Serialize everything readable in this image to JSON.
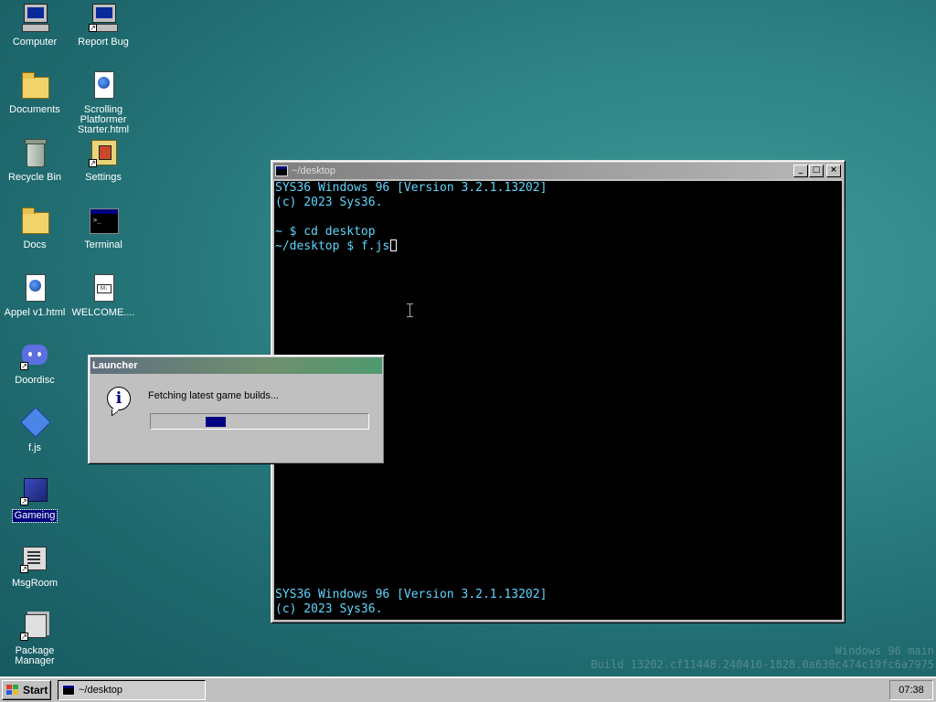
{
  "desktop_icons": [
    {
      "label": "Computer"
    },
    {
      "label": "Report Bug"
    },
    {
      "label": "Documents"
    },
    {
      "label": "Scrolling Platformer Starter.html"
    },
    {
      "label": "Recycle Bin"
    },
    {
      "label": "Settings"
    },
    {
      "label": "Docs"
    },
    {
      "label": "Terminal"
    },
    {
      "label": "Appel v1.html"
    },
    {
      "label": "WELCOME...."
    },
    {
      "label": "Doordisc"
    },
    {
      "label": "f.js"
    },
    {
      "label": "Gameing"
    },
    {
      "label": "MsgRoom"
    },
    {
      "label": "Package Manager"
    }
  ],
  "terminal": {
    "title": "~/desktop",
    "lines": [
      "SYS36 Windows 96 [Version 3.2.1.13202]",
      "(c) 2023 Sys36.",
      "",
      "~ $ cd desktop",
      "~/desktop $ f.js"
    ],
    "bottom_lines": [
      "SYS36 Windows 96 [Version 3.2.1.13202]",
      "(c) 2023 Sys36."
    ],
    "buttons": {
      "minimize": "_",
      "maximize": "□",
      "close": "×"
    }
  },
  "launcher": {
    "title": "Launcher",
    "message": "Fetching latest game builds...",
    "icon_glyph": "i",
    "progress_position": 0.28
  },
  "watermark": {
    "line1": "Windows 96 main",
    "line2": "Build 13202.cf11448.240410-1828.0a630c474c19fc6a7975"
  },
  "taskbar": {
    "start_label": "Start",
    "tasks": [
      {
        "label": "~/desktop"
      }
    ],
    "clock": "07:38"
  },
  "colors": {
    "desktop": "#2f8587",
    "terminal_text": "#5fd7ff",
    "selection": "#000080"
  }
}
